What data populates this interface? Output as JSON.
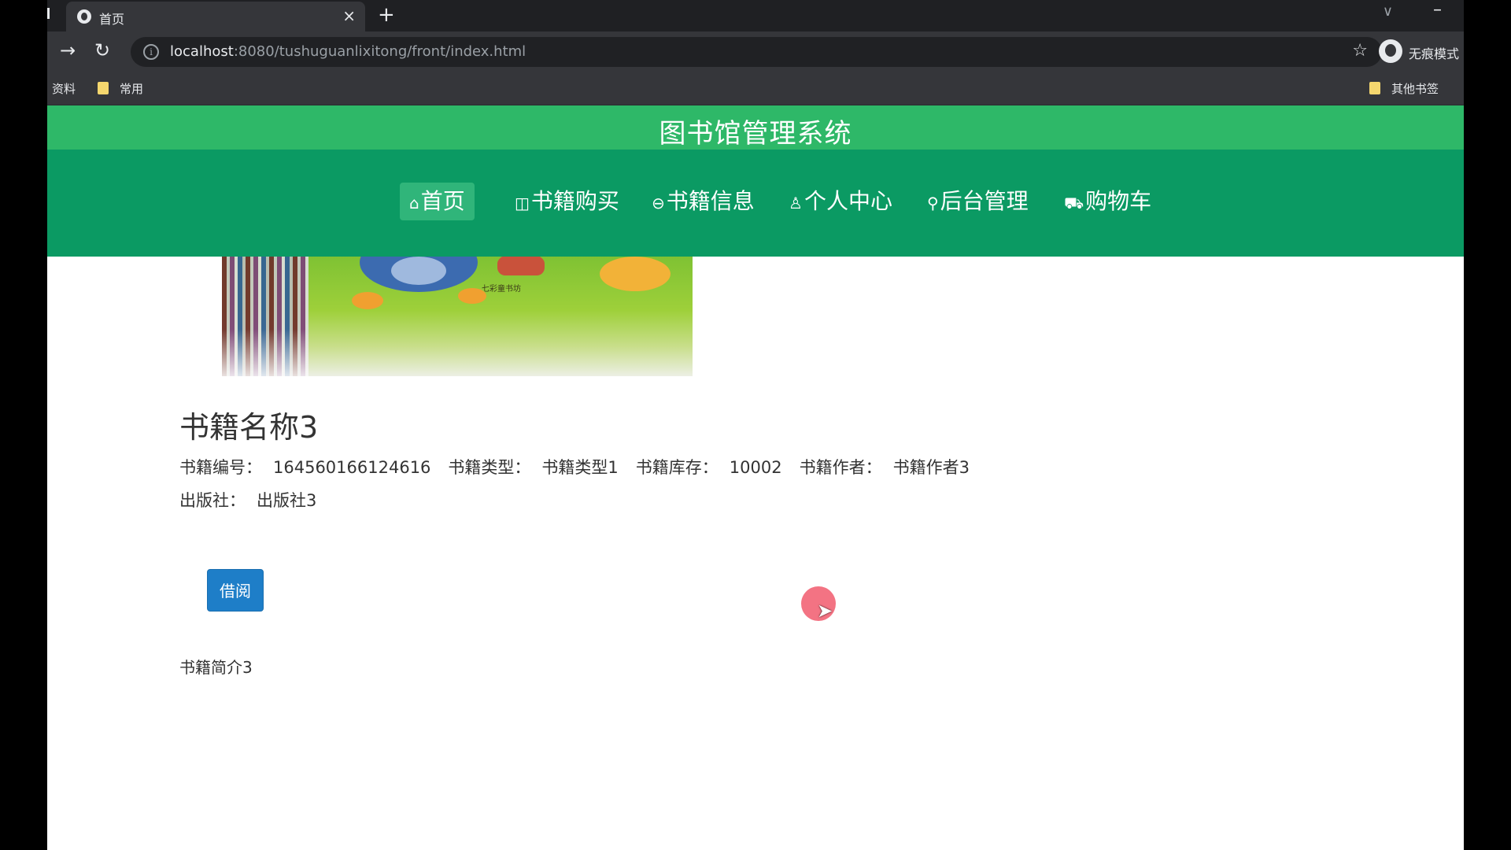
{
  "browser": {
    "tab": {
      "title": "首页"
    },
    "url": {
      "host": "localhost",
      "rest": ":8080/tushuguanlixitong/front/index.html"
    },
    "profile_label": "无痕模式",
    "bookmarks": {
      "left1": "资料",
      "left2": "常用",
      "right": "其他书签"
    }
  },
  "site": {
    "title": "图书馆管理系统",
    "nav": [
      {
        "icon": "⌂",
        "label": "首页"
      },
      {
        "icon": "◫",
        "label": "书籍购买"
      },
      {
        "icon": "⊖",
        "label": "书籍信息"
      },
      {
        "icon": "♙",
        "label": "个人中心"
      },
      {
        "icon": "⚲",
        "label": "后台管理"
      },
      {
        "icon": "⛟",
        "label": "购物车"
      }
    ]
  },
  "book": {
    "name": "书籍名称3",
    "number_label": "书籍编号：",
    "number_value": "164560166124616",
    "type_label": "书籍类型：",
    "type_value": "书籍类型1",
    "stock_label": "书籍库存：",
    "stock_value": "10002",
    "author_label": "书籍作者：",
    "author_value": "书籍作者3",
    "publisher_label": "出版社：",
    "publisher_value": "出版社3",
    "borrow_label": "借阅",
    "intro": "书籍简介3",
    "cover_caption": "七彩童书坊"
  },
  "icons": {
    "favicon": "globe-icon",
    "back": "arrow-forward-icon",
    "reload": "reload-icon",
    "info": "info-icon",
    "star": "star-icon",
    "profile": "incognito-icon"
  }
}
